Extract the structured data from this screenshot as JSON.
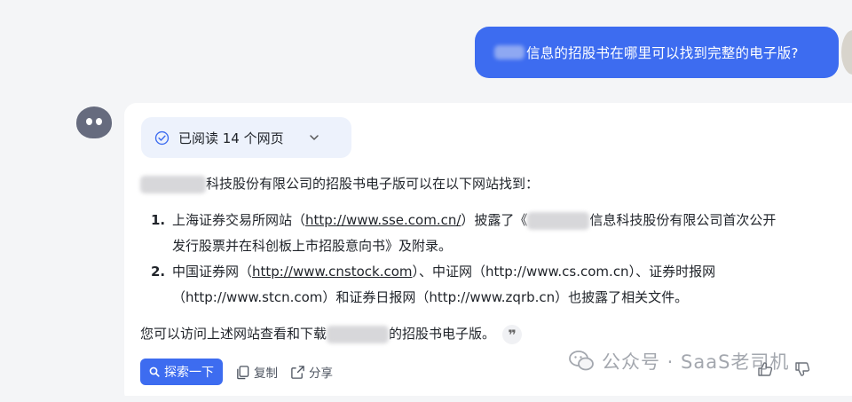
{
  "user_message": {
    "text": "信息的招股书在哪里可以找到完整的电子版?"
  },
  "answer": {
    "reading_status": "已阅读 14 个网页",
    "intro": "科技股份有限公司的招股书电子版可以在以下网站找到：",
    "items": [
      {
        "number": "1.",
        "line1_prefix": "上海证券交易所网站（",
        "line1_link": "http://www.sse.com.cn/",
        "line1_suffix_a": "）披露了《",
        "line1_suffix_b": "信息科技股份有限公司首次公开",
        "line2": "发行股票并在科创板上市招股意向书》及附录。"
      },
      {
        "number": "2.",
        "line1_prefix": "中国证券网（",
        "line1_link": "http://www.cnstock.com",
        "line1_suffix": "）、中证网（http://www.cs.com.cn）、证券时报网",
        "line2": "（http://www.stcn.com）和证券日报网（http://www.zqrb.cn）也披露了相关文件。"
      }
    ],
    "outro_prefix": "您可以访问上述网站查看和下载",
    "outro_suffix": "的招股书电子版。",
    "quote_glyph": "❞"
  },
  "actions": {
    "search_label": "探索一下",
    "copy_label": "复制",
    "share_label": "分享"
  },
  "watermark": {
    "text": "公众号 · SaaS老司机"
  },
  "colors": {
    "accent": "#3d6cf0",
    "background": "#f4f5f7",
    "card": "#ffffff",
    "pill": "#edf2fc"
  }
}
